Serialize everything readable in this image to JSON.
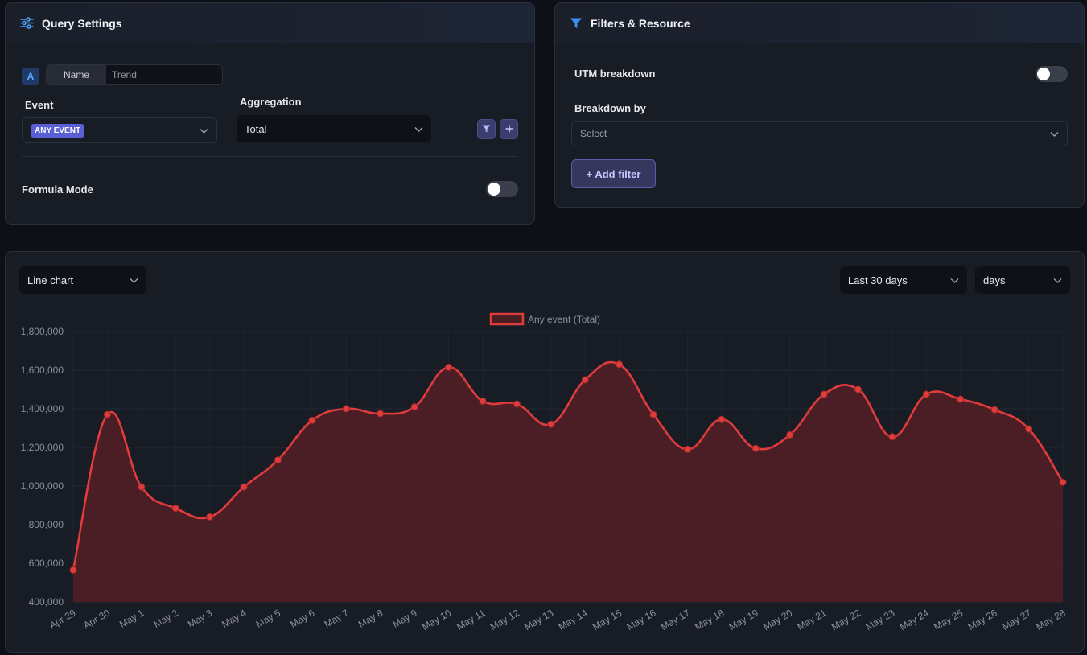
{
  "query_settings": {
    "title": "Query Settings",
    "series_letter": "A",
    "name_label": "Name",
    "name_value": "Trend",
    "event_label": "Event",
    "event_badge": "ANY EVENT",
    "aggregation_label": "Aggregation",
    "aggregation_value": "Total",
    "formula_mode_label": "Formula Mode"
  },
  "filters": {
    "title": "Filters & Resource",
    "utm_label": "UTM breakdown",
    "breakdown_label": "Breakdown by",
    "breakdown_placeholder": "Select",
    "add_filter_label": "+ Add filter"
  },
  "chart_controls": {
    "chart_type": "Line chart",
    "range": "Last 30 days",
    "interval": "days"
  },
  "colors": {
    "accent": "#e03c3c",
    "badge": "#5b5fd6",
    "filter_icon": "#3b8ff0"
  },
  "chart_data": {
    "type": "area",
    "legend": "Any event (Total)",
    "ylim": [
      400000,
      1800000
    ],
    "yticks": [
      400000,
      600000,
      800000,
      1000000,
      1200000,
      1400000,
      1600000,
      1800000
    ],
    "ytick_labels": [
      "400,000",
      "600,000",
      "800,000",
      "1,000,000",
      "1,200,000",
      "1,400,000",
      "1,600,000",
      "1,800,000"
    ],
    "categories": [
      "Apr 29",
      "Apr 30",
      "May 1",
      "May 2",
      "May 3",
      "May 4",
      "May 5",
      "May 6",
      "May 7",
      "May 8",
      "May 9",
      "May 10",
      "May 11",
      "May 12",
      "May 13",
      "May 14",
      "May 15",
      "May 16",
      "May 17",
      "May 18",
      "May 19",
      "May 20",
      "May 21",
      "May 22",
      "May 23",
      "May 24",
      "May 25",
      "May 26",
      "May 27",
      "May 28"
    ],
    "series": [
      {
        "name": "Any event (Total)",
        "values": [
          565000,
          1370000,
          995000,
          885000,
          840000,
          995000,
          1135000,
          1340000,
          1400000,
          1375000,
          1410000,
          1615000,
          1440000,
          1425000,
          1320000,
          1550000,
          1630000,
          1370000,
          1190000,
          1345000,
          1195000,
          1265000,
          1475000,
          1500000,
          1255000,
          1475000,
          1450000,
          1395000,
          1295000,
          1020000
        ]
      }
    ],
    "grid": true
  }
}
